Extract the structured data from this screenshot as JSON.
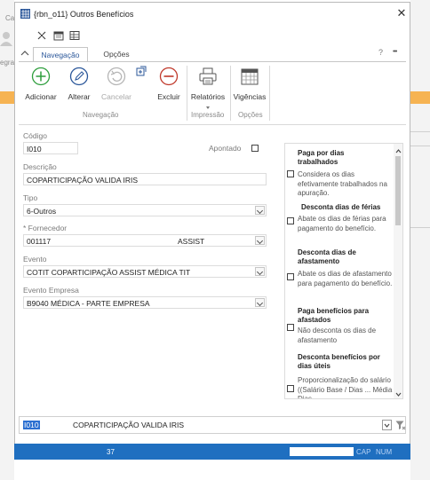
{
  "background": {
    "left_text_1": "Ca",
    "left_text_2": "egra"
  },
  "window": {
    "title": "{rbn_o11} Outros Benefícios",
    "close_label": "✕"
  },
  "tabs": [
    {
      "label": "Navegação",
      "active": true
    },
    {
      "label": "Opções",
      "active": false
    }
  ],
  "tab_bar": {
    "help_label": "?",
    "more_label": "•••"
  },
  "ribbon": {
    "buttons": [
      {
        "label": "Adicionar",
        "icon": "add-circle-icon",
        "enabled": true
      },
      {
        "label": "Alterar",
        "icon": "pencil-icon",
        "enabled": true
      },
      {
        "label": "Cancelar",
        "icon": "undo-icon",
        "enabled": false
      },
      {
        "label": "Excluir",
        "icon": "minus-circle-icon",
        "enabled": true
      },
      {
        "label": "Relatórios",
        "icon": "printer-icon",
        "enabled": true
      },
      {
        "label": "Vigências",
        "icon": "calendar-icon",
        "enabled": true
      }
    ],
    "groups": [
      "Navegação",
      "Impressão",
      "Opções"
    ]
  },
  "form": {
    "codigo_label": "Código",
    "codigo_value": "I010",
    "apontado_label": "Apontado",
    "descricao_label": "Descrição",
    "descricao_value": "COPARTICIPAÇÃO VALIDA IRIS",
    "tipo_label": "Tipo",
    "tipo_value": "6-Outros",
    "fornecedor_label": "* Fornecedor",
    "fornecedor_code": "001117",
    "fornecedor_name": "ASSIST",
    "evento_label": "Evento",
    "evento_value": "COTIT  COPARTICIPAÇÃO ASSIST MÉDICA TIT",
    "evento_empresa_label": "Evento Empresa",
    "evento_empresa_value": "B9040  MÉDICA - PARTE EMPRESA"
  },
  "options_panel": {
    "items": [
      {
        "title": "Paga por dias trabalhados",
        "desc": "Considera os dias efetivamente trabalhados na apuração.",
        "checked": false
      },
      {
        "title": "Desconta dias de férias",
        "desc": "Abate os dias de férias para pagamento do benefício.",
        "checked": false
      },
      {
        "title": "Desconta dias de afastamento",
        "desc": "Abate os dias de afastamento para pagamento do benefício.",
        "checked": false
      },
      {
        "title": "Paga benefícios para afastados",
        "desc": "Não desconta os dias de afastamento",
        "checked": false
      },
      {
        "title": "Desconta benefícios por dias úteis",
        "desc": "Proporcionalização do salário ((Salário Base / Dias ... Média Dias ...",
        "checked": false
      }
    ]
  },
  "bottom_bar": {
    "code": "I010",
    "description": "COPARTICIPAÇÃO VALIDA IRIS"
  },
  "status_bar": {
    "count": "37",
    "cap": "CAP",
    "num": "NUM"
  },
  "colors": {
    "accent": "#2b579a",
    "status_bar": "#1f6fc0",
    "background_band": "#f6b352",
    "add_icon": "#2e9e3d"
  }
}
